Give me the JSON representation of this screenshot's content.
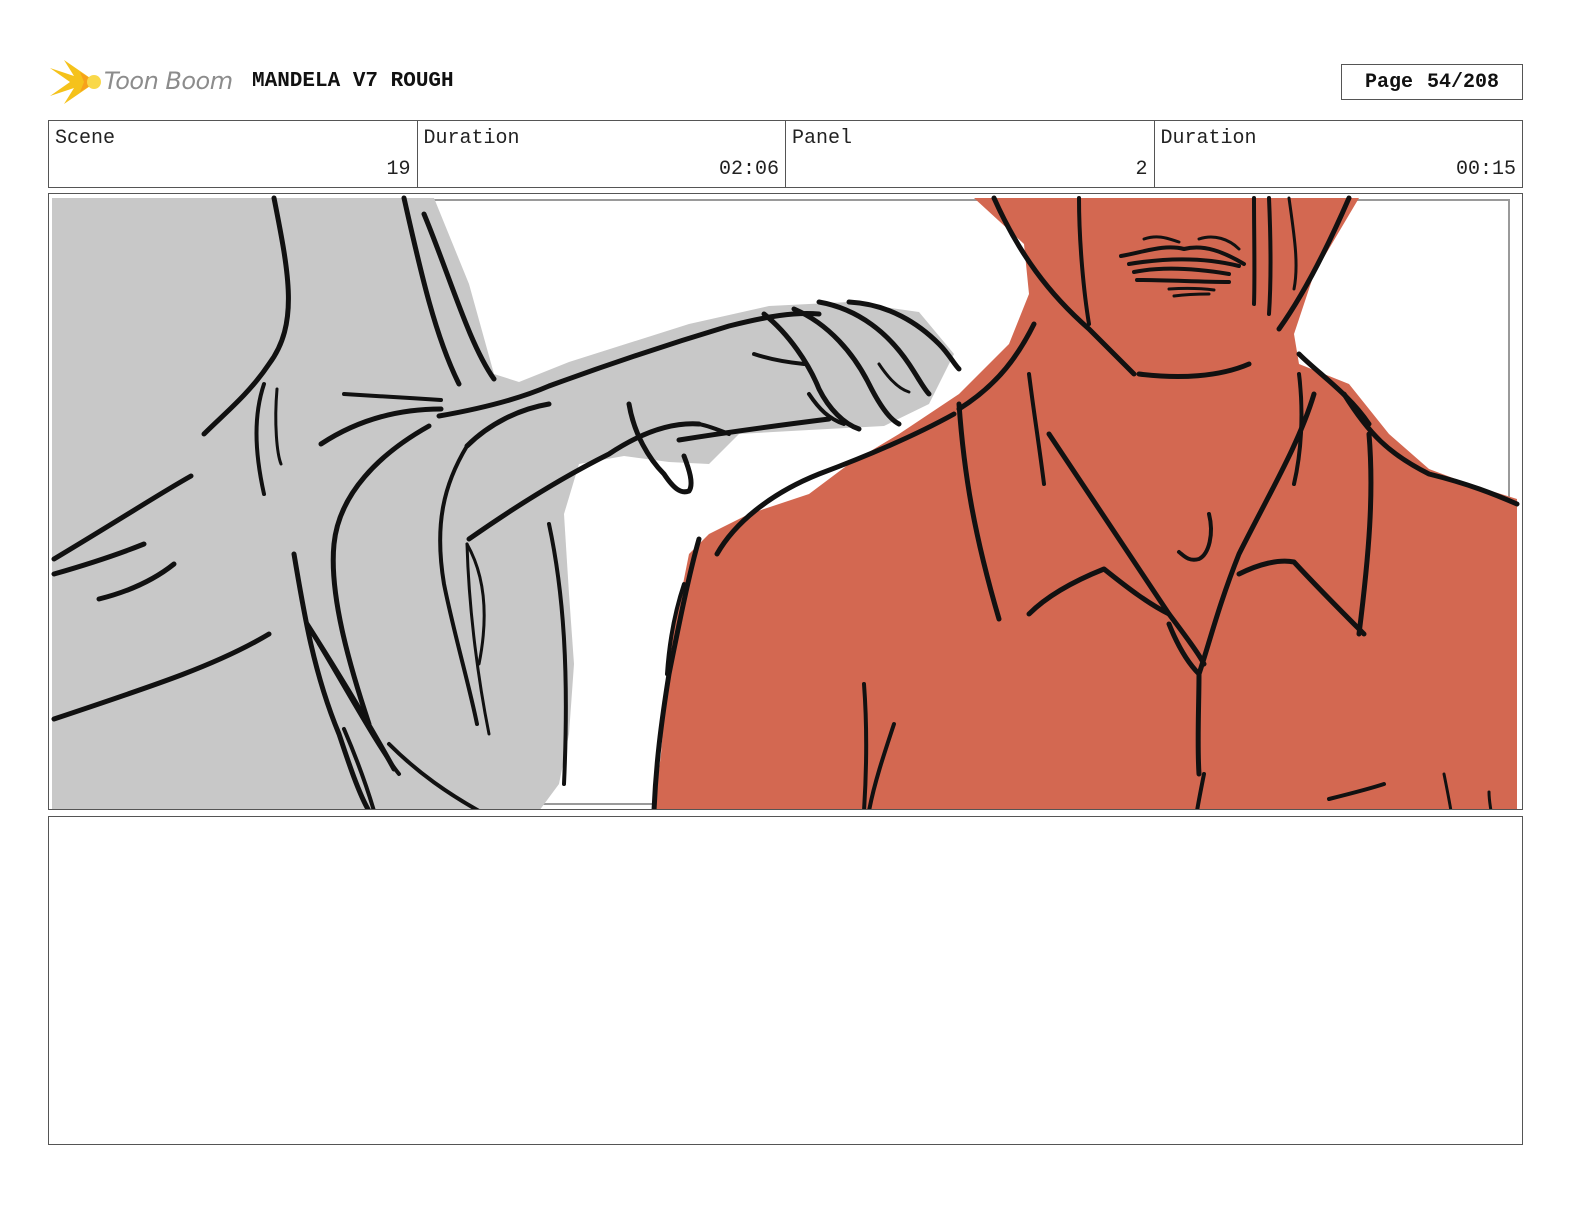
{
  "header": {
    "brand": "Toon Boom",
    "project_title": "MANDELA V7 ROUGH",
    "page_label": "Page",
    "page_value": "54/208"
  },
  "info": [
    {
      "label": "Scene",
      "value": "19"
    },
    {
      "label": "Duration",
      "value": "02:06"
    },
    {
      "label": "Panel",
      "value": "2"
    },
    {
      "label": "Duration",
      "value": "00:15"
    }
  ],
  "panel": {
    "left_figure_fill": "#c8c8c8",
    "right_figure_fill": "#d36851",
    "line_color": "#111111"
  },
  "notes": {
    "text": ""
  }
}
